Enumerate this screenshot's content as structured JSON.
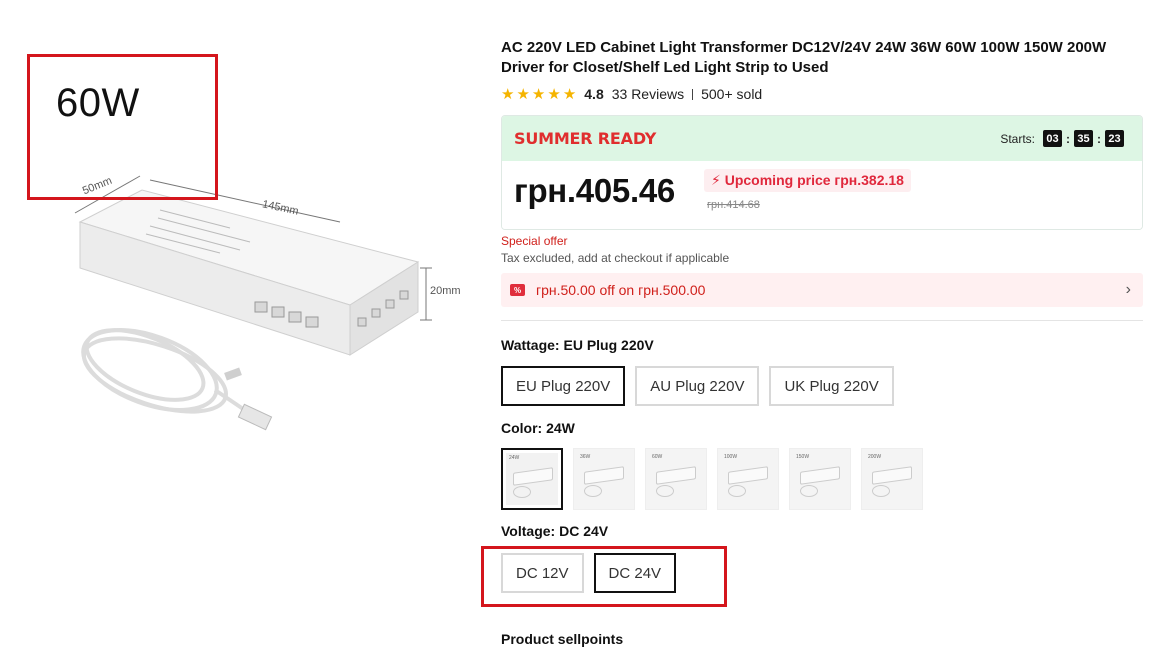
{
  "image": {
    "wattage_text": "60W",
    "dim_width": "50mm",
    "dim_length": "145mm",
    "dim_height": "20mm"
  },
  "product": {
    "title": "AC 220V LED Cabinet Light Transformer DC12V/24V 24W 36W 60W 100W 150W 200W Driver for Closet/Shelf Led Light Strip to Used",
    "rating": "4.8",
    "reviews": "33 Reviews",
    "sold": "500+ sold",
    "star_color": "#f5b400"
  },
  "promo": {
    "title": "SUMMER READY",
    "starts_label": "Starts:",
    "countdown": [
      "03",
      "35",
      "23"
    ],
    "price": "грн.405.46",
    "upcoming": "Upcoming price грн.382.18",
    "original_price": "грн.414.68",
    "accent": "#e02e2e",
    "head_bg": "#ddf6e4"
  },
  "offer": {
    "special": "Special offer",
    "tax": "Tax excluded, add at checkout if applicable",
    "coupon_icon": "%",
    "coupon": "грн.50.00 off on грн.500.00"
  },
  "wattage": {
    "label": "Wattage:",
    "selected": "EU Plug 220V",
    "options": [
      "EU Plug 220V",
      "AU Plug 220V",
      "UK Plug 220V"
    ]
  },
  "color": {
    "label": "Color:",
    "selected": "24W",
    "options": [
      "24W",
      "36W",
      "60W",
      "100W",
      "150W",
      "200W"
    ]
  },
  "voltage": {
    "label": "Voltage:",
    "selected": "DC 24V",
    "options": [
      "DC 12V",
      "DC 24V"
    ]
  },
  "sellpoints_heading": "Product sellpoints"
}
